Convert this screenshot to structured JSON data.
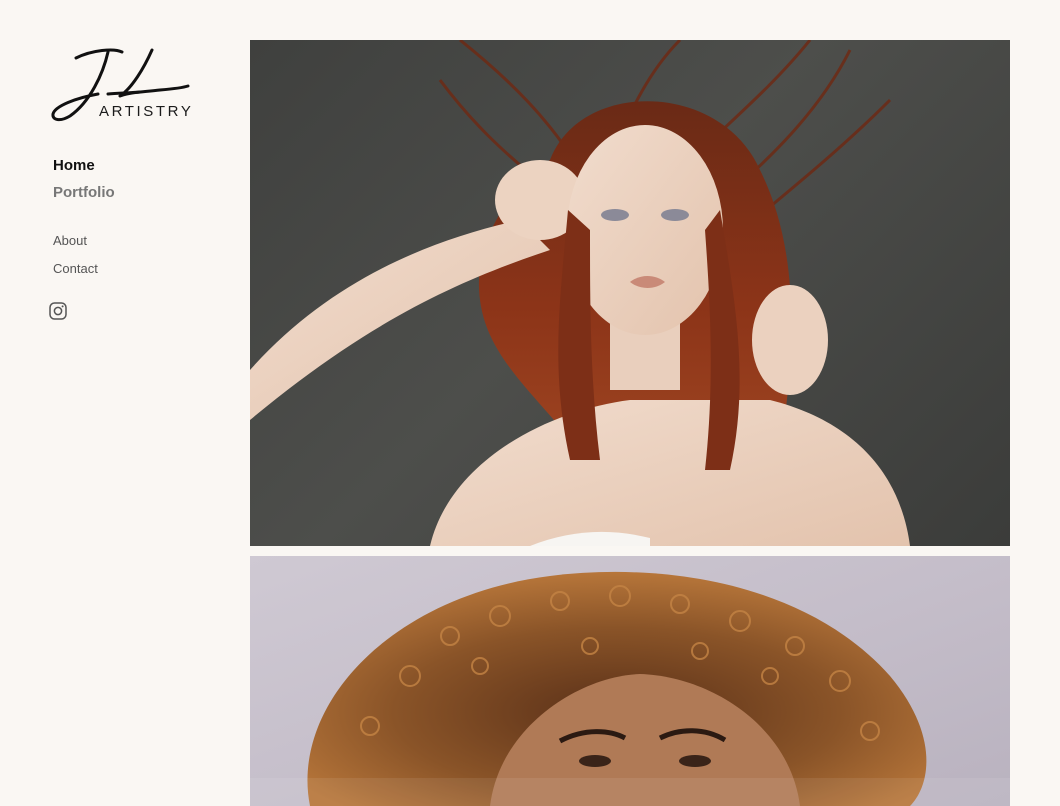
{
  "brand": {
    "logo_text": "ARTISTRY"
  },
  "nav": {
    "primary": [
      "Home",
      "Portfolio"
    ],
    "secondary": [
      "About",
      "Contact"
    ]
  },
  "social": {
    "icon": "instagram-icon"
  },
  "gallery": {
    "images": [
      {
        "name": "portrait-red-hair"
      },
      {
        "name": "portrait-curly-hair"
      }
    ]
  }
}
